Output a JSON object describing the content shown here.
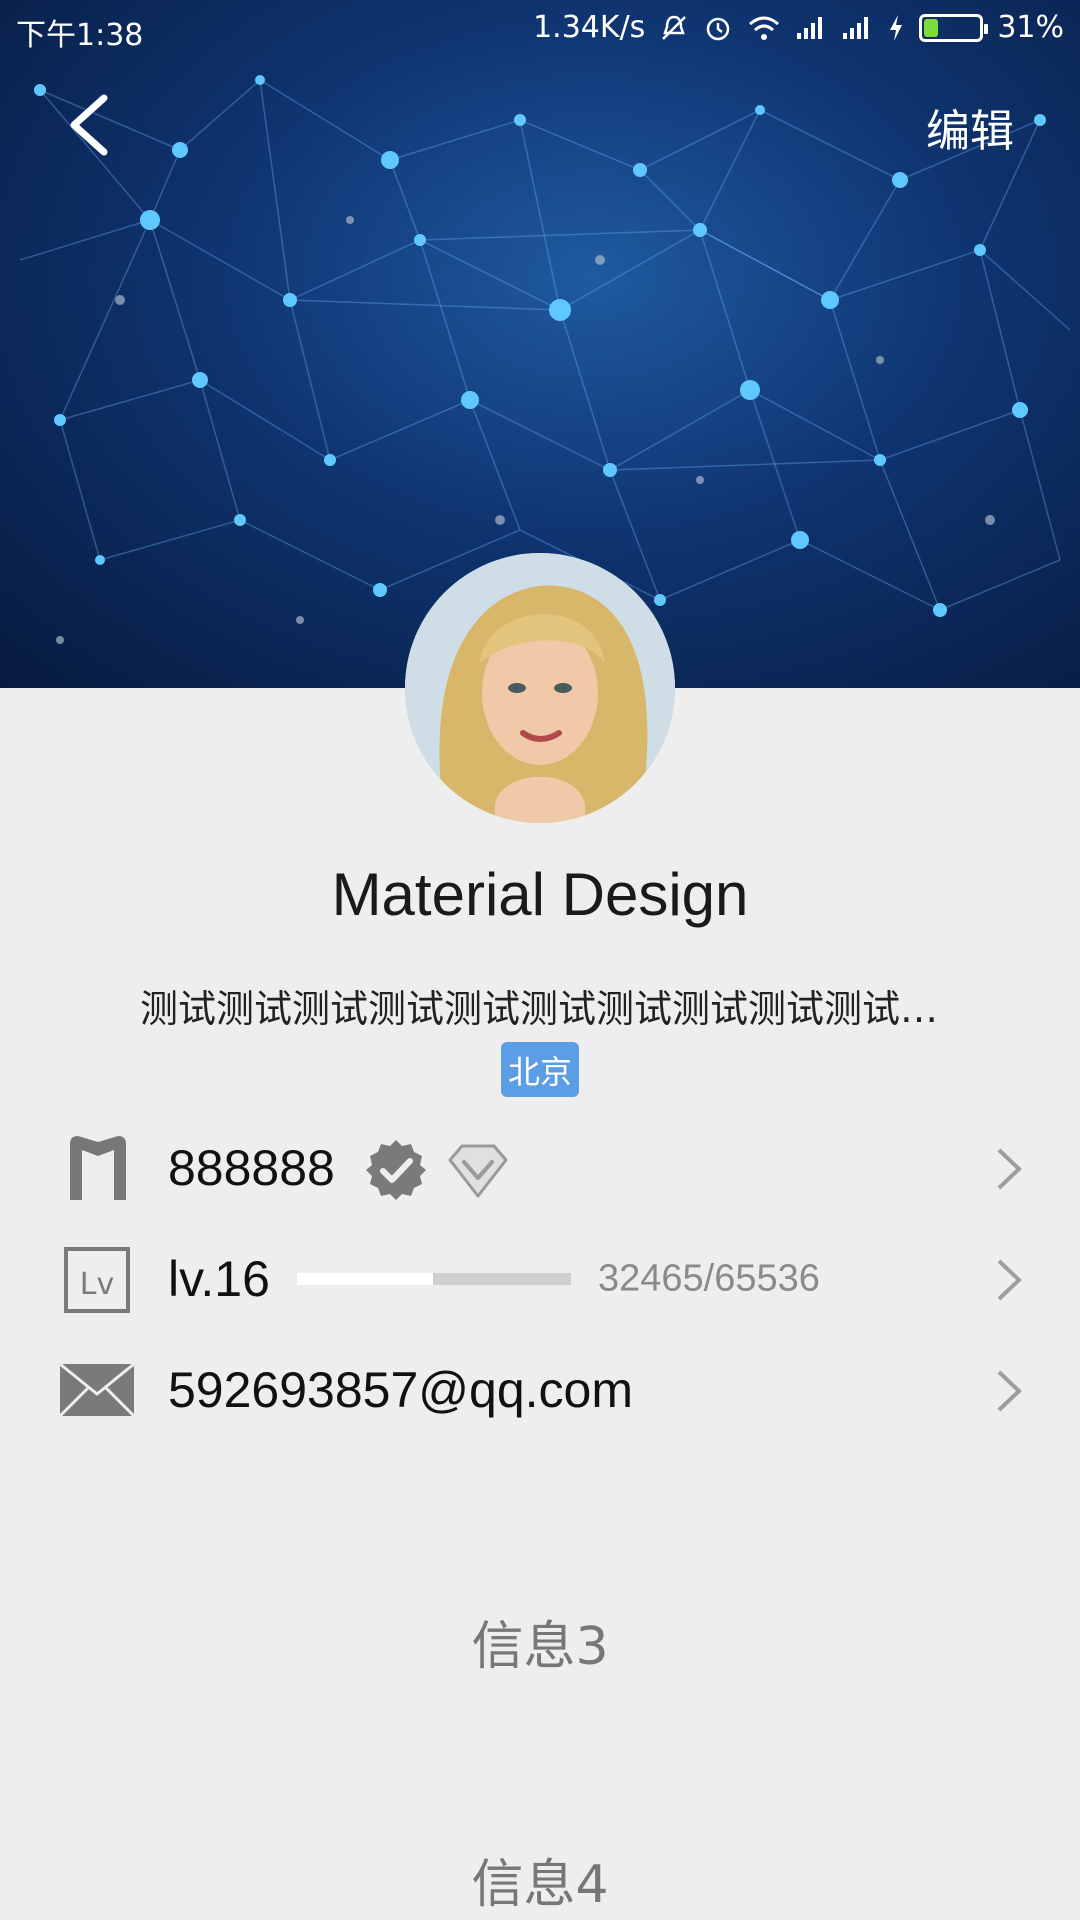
{
  "status_bar": {
    "time": "下午1:38",
    "net_speed": "1.34K/s",
    "battery_percent": "31%",
    "battery_level": 0.31,
    "icons": [
      "mute-icon",
      "alarm-icon",
      "wifi-icon",
      "signal-icon",
      "signal-icon",
      "charging-icon"
    ]
  },
  "header": {
    "back_icon": "back-arrow-icon",
    "edit_label": "编辑"
  },
  "profile": {
    "name": "Material Design",
    "signature": "测试测试测试测试测试测试测试测试测试测试测…",
    "location": "北京"
  },
  "rows": {
    "id": {
      "icon": "m-logo-icon",
      "value": "888888",
      "badges": [
        "verified-icon",
        "diamond-icon"
      ]
    },
    "level": {
      "icon": "level-icon",
      "label": "lv.16",
      "progress_text": "32465/65536",
      "progress": 0.4954
    },
    "email": {
      "icon": "mail-icon",
      "value": "592693857@qq.com"
    }
  },
  "sections": {
    "info3": "信息3",
    "info4": "信息4"
  },
  "colors": {
    "accent": "#5b9ee6",
    "battery": "#7ddc3b",
    "background": "#eeeeee"
  }
}
